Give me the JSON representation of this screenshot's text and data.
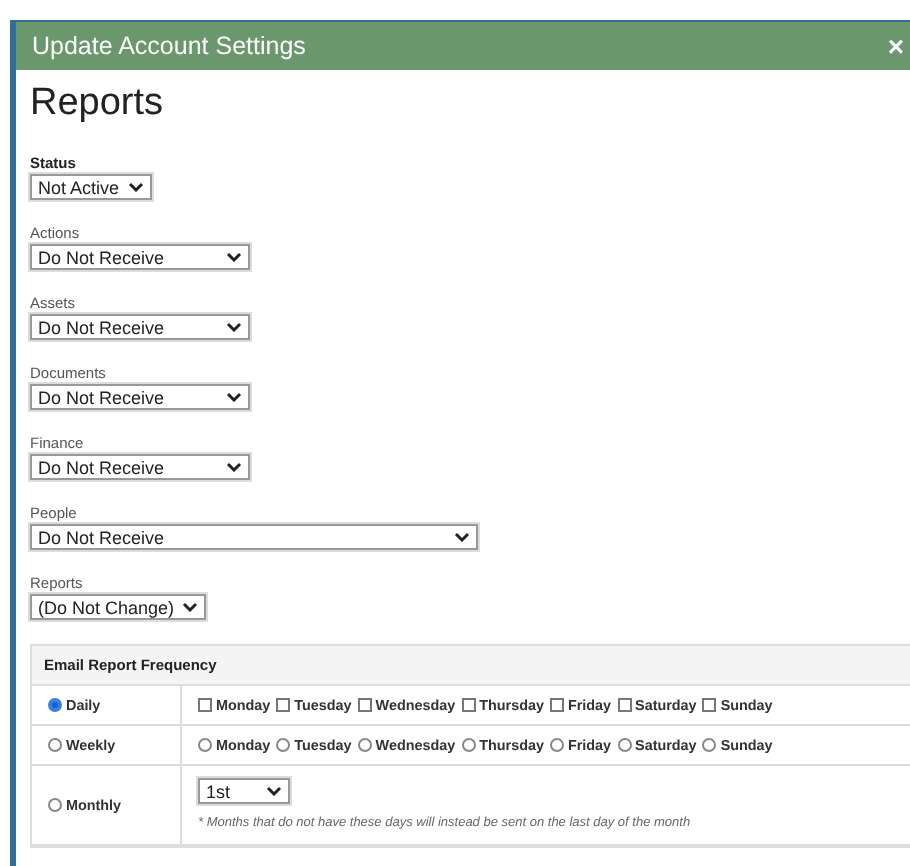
{
  "dialog": {
    "title": "Update Account Settings",
    "close": "×"
  },
  "heading": "Reports",
  "fields": [
    {
      "label": "Status",
      "value": "Not Active",
      "kind": "compact",
      "emphasis": true
    },
    {
      "label": "Actions",
      "value": "Do Not Receive",
      "kind": "standard",
      "emphasis": false
    },
    {
      "label": "Assets",
      "value": "Do Not Receive",
      "kind": "standard",
      "emphasis": false
    },
    {
      "label": "Documents",
      "value": "Do Not Receive",
      "kind": "standard",
      "emphasis": false
    },
    {
      "label": "Finance",
      "value": "Do Not Receive",
      "kind": "standard",
      "emphasis": false
    },
    {
      "label": "People",
      "value": "Do Not Receive",
      "kind": "wide",
      "emphasis": false
    },
    {
      "label": "Reports",
      "value": "(Do Not Change)",
      "kind": "compact",
      "emphasis": false
    }
  ],
  "frequency": {
    "title": "Email Report Frequency",
    "options": [
      {
        "label": "Daily",
        "selected": true,
        "kind": "checkboxes",
        "days": [
          {
            "label": "Monday",
            "checked": false
          },
          {
            "label": "Tuesday",
            "checked": false
          },
          {
            "label": "Wednesday",
            "checked": false
          },
          {
            "label": "Thursday",
            "checked": false
          },
          {
            "label": "Friday",
            "checked": false
          },
          {
            "label": "Saturday",
            "checked": false
          },
          {
            "label": "Sunday",
            "checked": false
          }
        ]
      },
      {
        "label": "Weekly",
        "selected": false,
        "kind": "radios",
        "days": [
          {
            "label": "Monday",
            "selected": false
          },
          {
            "label": "Tuesday",
            "selected": false
          },
          {
            "label": "Wednesday",
            "selected": false
          },
          {
            "label": "Thursday",
            "selected": false
          },
          {
            "label": "Friday",
            "selected": false
          },
          {
            "label": "Saturday",
            "selected": false
          },
          {
            "label": "Sunday",
            "selected": false
          }
        ]
      },
      {
        "label": "Monthly",
        "selected": false,
        "kind": "dropdown",
        "value": "1st",
        "note": "* Months that do not have these days will instead be sent on the last day of the month"
      }
    ]
  }
}
